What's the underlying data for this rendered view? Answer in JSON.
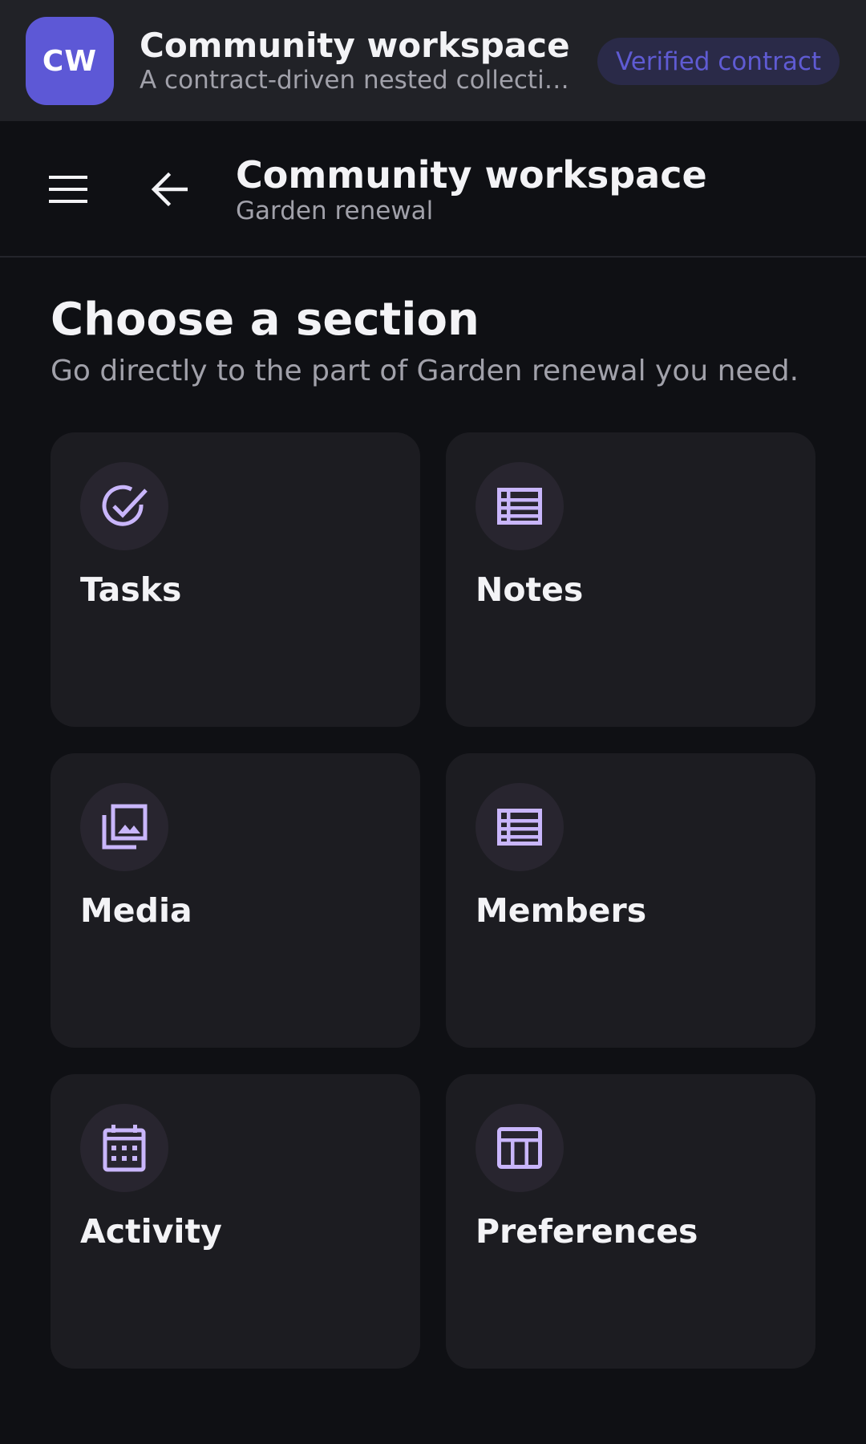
{
  "app": {
    "logo_text": "CW",
    "title": "Community workspace",
    "subtitle": "A contract-driven nested collection browser",
    "badge": "Verified contract"
  },
  "nav": {
    "title": "Community workspace",
    "subtitle": "Garden renewal",
    "menu_icon": "menu-icon",
    "back_icon": "arrow-left-icon"
  },
  "section": {
    "heading": "Choose a section",
    "description": "Go directly to the part of Garden renewal you need."
  },
  "cards": [
    {
      "label": "Tasks",
      "icon": "check-circle-icon"
    },
    {
      "label": "Notes",
      "icon": "list-icon"
    },
    {
      "label": "Media",
      "icon": "photo-library-icon"
    },
    {
      "label": "Members",
      "icon": "list-icon"
    },
    {
      "label": "Activity",
      "icon": "calendar-icon"
    },
    {
      "label": "Preferences",
      "icon": "table-icon"
    }
  ],
  "colors": {
    "accent": "#5d58d6",
    "icon": "#c9b6fb",
    "background": "#0f1014",
    "card": "#1c1c21"
  }
}
